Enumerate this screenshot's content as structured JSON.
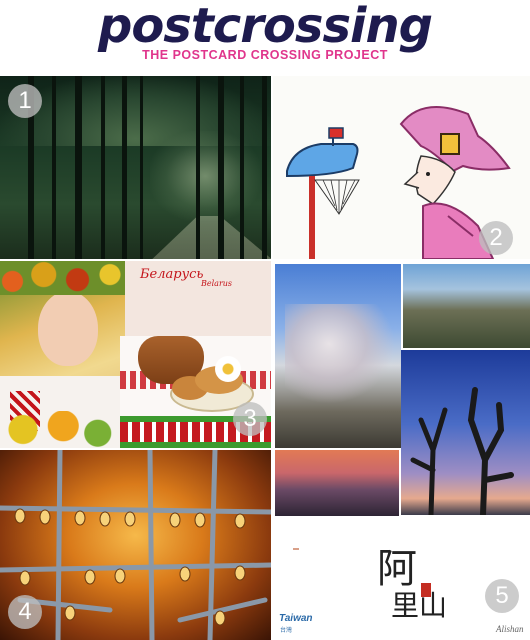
{
  "header": {
    "logo_text": "postcrossing",
    "tagline": "THE POSTCARD CROSSING PROJECT"
  },
  "colors": {
    "logo": "#1e1b4e",
    "tagline": "#e0358c",
    "badge": "#bdbdbd"
  },
  "postcards": [
    {
      "number": "1",
      "subject": "bamboo-forest"
    },
    {
      "number": "2",
      "subject": "cartoon-witch-mailbox"
    },
    {
      "number": "3",
      "subject": "belarus",
      "title": "Беларусь",
      "subtitle": "Belarus"
    },
    {
      "number": "4",
      "subject": "water-droplets-on-branches"
    },
    {
      "number": "5",
      "subject": "alishan-taiwan",
      "calligraphy_top": "阿",
      "calligraphy_bottom": "里山",
      "brand": "Taiwan",
      "brand_sub": "台灣",
      "caption": "Alishan"
    }
  ]
}
